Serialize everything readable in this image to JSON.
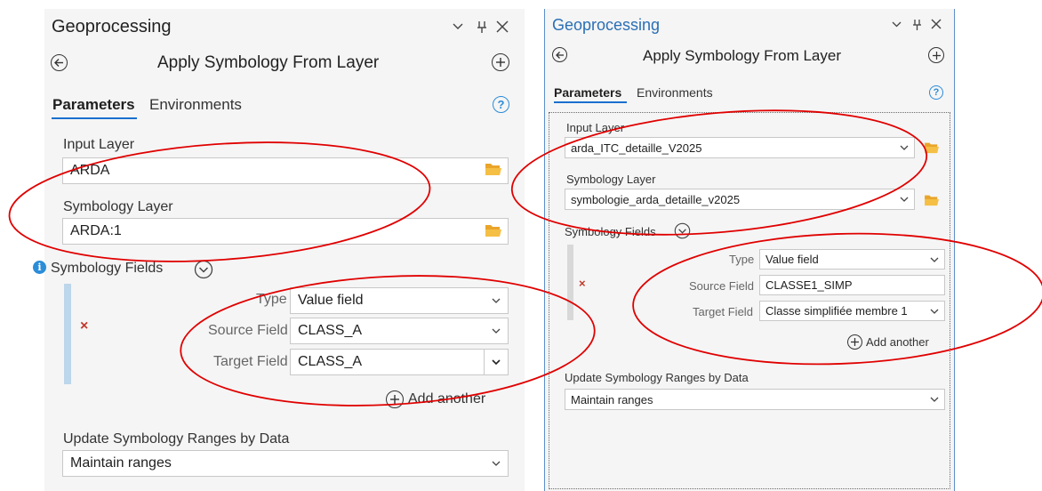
{
  "left": {
    "title": "Geoprocessing",
    "tool_title": "Apply Symbology From Layer",
    "tabs": {
      "parameters": "Parameters",
      "environments": "Environments"
    },
    "input_layer": {
      "label": "Input Layer",
      "value": "ARDA"
    },
    "symbology_layer": {
      "label": "Symbology Layer",
      "value": "ARDA:1"
    },
    "symbology_fields": {
      "label": "Symbology Fields",
      "type_label": "Type",
      "type_value": "Value field",
      "source_label": "Source Field",
      "source_value": "CLASS_A",
      "target_label": "Target Field",
      "target_value": "CLASS_A",
      "add_another": "Add another"
    },
    "update_ranges": {
      "label": "Update Symbology Ranges by Data",
      "value": "Maintain ranges"
    }
  },
  "right": {
    "title": "Geoprocessing",
    "tool_title": "Apply Symbology From Layer",
    "tabs": {
      "parameters": "Parameters",
      "environments": "Environments"
    },
    "input_layer": {
      "label": "Input Layer",
      "value": "arda_ITC_detaille_V2025"
    },
    "symbology_layer": {
      "label": "Symbology Layer",
      "value": "symbologie_arda_detaille_v2025"
    },
    "symbology_fields": {
      "label": "Symbology Fields",
      "type_label": "Type",
      "type_value": "Value field",
      "source_label": "Source Field",
      "source_value": "CLASSE1_SIMP",
      "target_label": "Target Field",
      "target_value": "Classe simplifiée membre 1",
      "add_another": "Add another"
    },
    "update_ranges": {
      "label": "Update Symbology Ranges by Data",
      "value": "Maintain ranges"
    }
  },
  "colors": {
    "accent": "#1b6fcf",
    "right_title": "#2a6fb5",
    "folder": "#f2b33d",
    "annotation_red": "#e00000",
    "remove_x": "#c0392b"
  },
  "icons": {
    "back": "back-arrow-circle-icon",
    "add_tool": "plus-circle-icon",
    "collapse": "chevron-down-icon",
    "pin": "pin-icon",
    "close": "close-icon",
    "browse": "folder-open-icon",
    "help": "question-circle-icon",
    "info": "info-icon",
    "remove": "remove-x-icon"
  }
}
